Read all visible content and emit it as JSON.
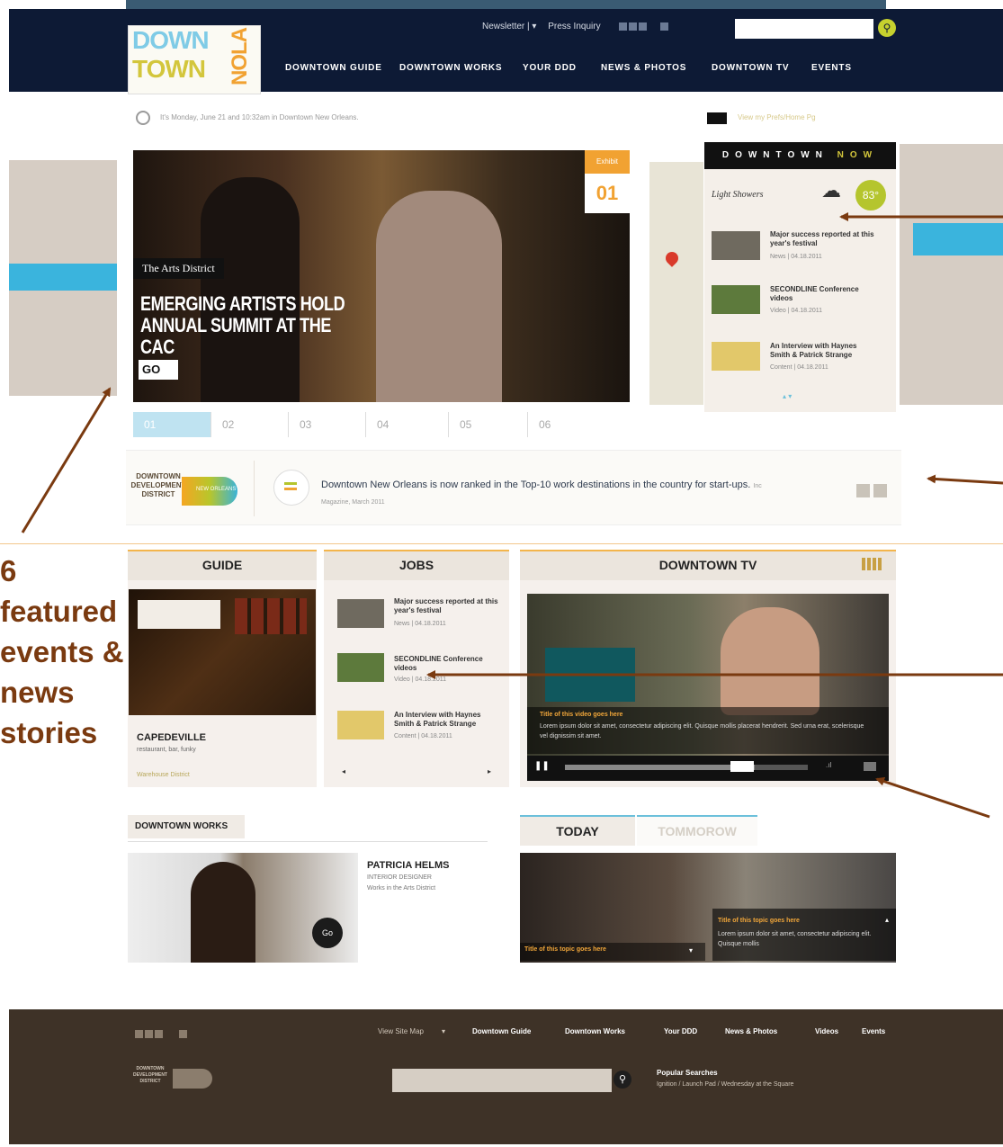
{
  "header": {
    "logo_lines": [
      "DOWN",
      "TOWN",
      "NOLA"
    ],
    "utility": {
      "newsletter": "Newsletter",
      "press": "Press Inquiry"
    },
    "nav": [
      "DOWNTOWN GUIDE",
      "DOWNTOWN WORKS",
      "YOUR DDD",
      "NEWS & PHOTOS",
      "DOWNTOWN TV",
      "EVENTS"
    ]
  },
  "date_bar": {
    "text": "It's Monday, June 21 and 10:32am in Downtown New Orleans.",
    "preferences": "View my Prefs/Home Pg"
  },
  "hero": {
    "tag": "The Arts District",
    "headline": "EMERGING ARTISTS HOLD ANNUAL SUMMIT AT THE CAC",
    "go": "GO",
    "flag_category": "Exhibit",
    "flag_number": "01",
    "tabs": [
      "01",
      "02",
      "03",
      "04",
      "05",
      "06"
    ],
    "active_tab": 0
  },
  "downtown_now": {
    "title_left": "DOWNTOWN",
    "title_right": "NOW",
    "weather": "Light Showers",
    "temp": "83°",
    "items": [
      {
        "title": "Major success reported at this year's festival",
        "meta": "News | 04.18.2011"
      },
      {
        "title": "SECONDLINE Conference videos",
        "meta": "Video | 04.18.2011"
      },
      {
        "title": "An Interview with Haynes Smith & Patrick Strange",
        "meta": "Content | 04.18.2011"
      }
    ]
  },
  "ticker": {
    "logo_text": "DOWNTOWN DEVELOPMENT DISTRICT",
    "logo_tag": "NEW ORLEANS",
    "text": "Downtown New Orleans is now ranked in the Top-10 work destinations in the country for start-ups.",
    "source": "Inc Magazine, March 2011"
  },
  "guide": {
    "header": "GUIDE",
    "name": "CAPEDEVILLE",
    "sub": "restaurant, bar, funky",
    "location": "Warehouse District"
  },
  "jobs": {
    "header": "JOBS",
    "items": [
      {
        "title": "Major success reported at this year's festival",
        "meta": "News | 04.18.2011"
      },
      {
        "title": "SECONDLINE Conference videos",
        "meta": "Video | 04.18.2011"
      },
      {
        "title": "An Interview with Haynes Smith & Patrick Strange",
        "meta": "Content | 04.18.2011"
      }
    ],
    "prev": "◂",
    "next": "▸"
  },
  "downtown_tv": {
    "header": "DOWNTOWN TV",
    "caption_title": "Title of this video goes here",
    "caption_body": "Lorem ipsum dolor sit amet, consectetur adipiscing elit. Quisque mollis placerat hendrerit. Sed urna erat, scelerisque vel dignissim sit amet.",
    "progress": 0.78
  },
  "works": {
    "header": "DOWNTOWN WORKS",
    "name": "PATRICIA HELMS",
    "role": "INTERIOR DESIGNER",
    "location": "Works in the Arts District",
    "go": "Go"
  },
  "today": {
    "tab_today": "TODAY",
    "tab_tomorrow": "TOMMOROW",
    "left_title": "Title of this topic goes here",
    "right_title": "Title of this topic goes here",
    "right_body": "Lorem ipsum dolor sit amet, consectetur adipiscing elit. Quisque mollis"
  },
  "footer": {
    "sitemap": "View Site Map",
    "links": [
      "Downtown Guide",
      "Downtown Works",
      "Your DDD",
      "News & Photos",
      "Videos",
      "Events"
    ],
    "popular_title": "Popular Searches",
    "popular_body": "Ignition / Launch Pad / Wednesday at the Square"
  },
  "annotation": {
    "text": "6 featured events & news stories"
  },
  "colors": {
    "navy": "#0d1a35",
    "accent_orange": "#f1a232",
    "accent_green": "#b5c52d",
    "accent_blue": "#39b3d8",
    "footer_brown": "#3e3227",
    "annotation_brown": "#7a3a10"
  }
}
